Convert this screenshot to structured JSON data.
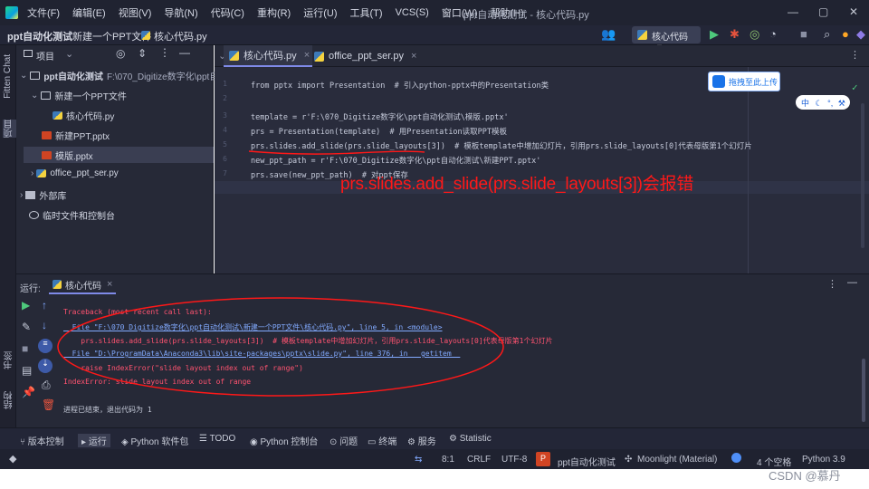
{
  "menubar": {
    "items": [
      "文件(F)",
      "编辑(E)",
      "视图(V)",
      "导航(N)",
      "代码(C)",
      "重构(R)",
      "运行(U)",
      "工具(T)",
      "VCS(S)",
      "窗口(W)",
      "帮助(H)"
    ],
    "window_title": "ppt自动化测试 - 核心代码.py"
  },
  "toolbar": {
    "breadcrumb": [
      "ppt自动化测试",
      "新建一个PPT文件",
      "核心代码.py"
    ],
    "run_config": "核心代码"
  },
  "left_strip": {
    "labels": [
      "Fitten Chat",
      "项目"
    ]
  },
  "project": {
    "header": "项目",
    "tree": [
      {
        "label": "ppt自动化测试",
        "path": "F:\\070_Digitize数字化\\ppt自动化"
      },
      {
        "label": "新建一个PPT文件"
      },
      {
        "label": "核心代码.py"
      },
      {
        "label": "新建PPT.pptx"
      },
      {
        "label": "模版.pptx"
      },
      {
        "label": "office_ppt_ser.py"
      },
      {
        "label": "外部库"
      },
      {
        "label": "临时文件和控制台"
      }
    ]
  },
  "editor": {
    "tabs": [
      "核心代码.py",
      "office_ppt_ser.py"
    ],
    "line_numbers": [
      "1",
      "2",
      "3",
      "4",
      "5",
      "6",
      "7",
      "8"
    ],
    "lines": [
      "from pptx import Presentation  # 引入python-pptx中的Presentation类",
      "",
      "template = r'F:\\070_Digitize数字化\\ppt自动化测试\\模版.pptx'",
      "prs = Presentation(template)  # 用Presentation读取PPT模板",
      "prs.slides.add_slide(prs.slide_layouts[3])  # 模板template中增加幻灯片，引用prs.slide_layouts[0]代表母版第1个幻灯片",
      "new_ppt_path = r'F:\\070_Digitize数字化\\ppt自动化测试\\新建PPT.pptx'",
      "prs.save(new_ppt_path)  # 对ppt保存",
      ""
    ],
    "annotation": "prs.slides.add_slide(prs.slide_layouts[3])会报错",
    "upload_button": "拖拽至此上传",
    "ime_label": "中"
  },
  "run": {
    "label": "运行:",
    "tab": "核心代码",
    "console": [
      "Traceback (most recent call last):",
      "  File \"F:\\070_Digitize数字化\\ppt自动化测试\\新建一个PPT文件\\核心代码.py\", line 5, in <module>",
      "    prs.slides.add_slide(prs.slide_layouts[3])  # 模板template中增加幻灯片，引用prs.slide_layouts[0]代表母版第1个幻灯片",
      "  File \"D:\\ProgramData\\Anaconda3\\lib\\site-packages\\pptx\\slide.py\", line 376, in __getitem__",
      "    raise IndexError(\"slide layout index out of range\")",
      "IndexError: slide layout index out of range",
      "",
      "进程已结束，退出代码为 1"
    ],
    "side_labels": [
      "书签",
      "结构"
    ]
  },
  "tool_tabs": [
    "版本控制",
    "运行",
    "Python 软件包",
    "TODO",
    "Python 控制台",
    "问题",
    "终端",
    "服务",
    "Statistic"
  ],
  "status": {
    "position": "8:1",
    "line_sep": "CRLF",
    "encoding": "UTF-8",
    "project": "ppt自动化测试",
    "theme": "Moonlight (Material)",
    "indent": "4 个空格",
    "interpreter": "Python 3.9"
  },
  "watermark": "CSDN @慕丹",
  "colors": {
    "accent": "#7f8ae8",
    "error": "#ff5370",
    "annotation": "#ff1818"
  }
}
